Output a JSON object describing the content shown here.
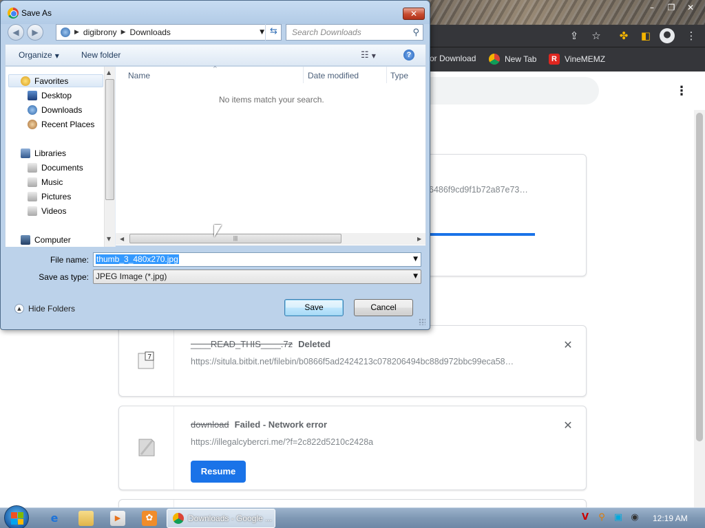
{
  "browser": {
    "bookmarks": [
      {
        "label": "or Download",
        "icon": "bookmark-icon"
      },
      {
        "label": "New Tab",
        "icon": "chrome-icon"
      },
      {
        "label": "VineMEMZ",
        "icon": "r-logo-icon",
        "color": "#e0261f"
      }
    ]
  },
  "downloads": {
    "cards": [
      {
        "url": "6486f9cd9f1b72a87e73…",
        "progress": 0.75
      },
      {
        "filename": "____READ_THIS____.7z",
        "status": "Deleted",
        "url": "https://situla.bitbit.net/filebin/b0866f5ad2424213c078206494bc88d972bbc99eca58…",
        "icon": "archive-file-icon"
      },
      {
        "filename": "download",
        "status": "Failed - Network error",
        "url": "https://illegalcybercri.me/?f=2c822d5210c2428a",
        "action": "Resume",
        "icon": "broken-file-icon"
      }
    ],
    "accent_color": "#1a73e8"
  },
  "dialog": {
    "title": "Save As",
    "breadcrumb": [
      "digibrony",
      "Downloads"
    ],
    "search_placeholder": "Search Downloads",
    "toolbar": {
      "organize": "Organize",
      "new_folder": "New folder"
    },
    "nav": {
      "favorites": {
        "label": "Favorites",
        "items": [
          "Desktop",
          "Downloads",
          "Recent Places"
        ]
      },
      "libraries": {
        "label": "Libraries",
        "items": [
          "Documents",
          "Music",
          "Pictures",
          "Videos"
        ]
      },
      "computer": "Computer"
    },
    "columns": [
      "Name",
      "Date modified",
      "Type"
    ],
    "empty_message": "No items match your search.",
    "file_name_label": "File name:",
    "file_name_value": "thumb_3_480x270.jpg",
    "save_type_label": "Save as type:",
    "save_type_value": "JPEG Image (*.jpg)",
    "hide_folders": "Hide Folders",
    "save_button": "Save",
    "cancel_button": "Cancel"
  },
  "taskbar": {
    "active_task": "Downloads - Google ...",
    "clock": "12:19 AM"
  }
}
